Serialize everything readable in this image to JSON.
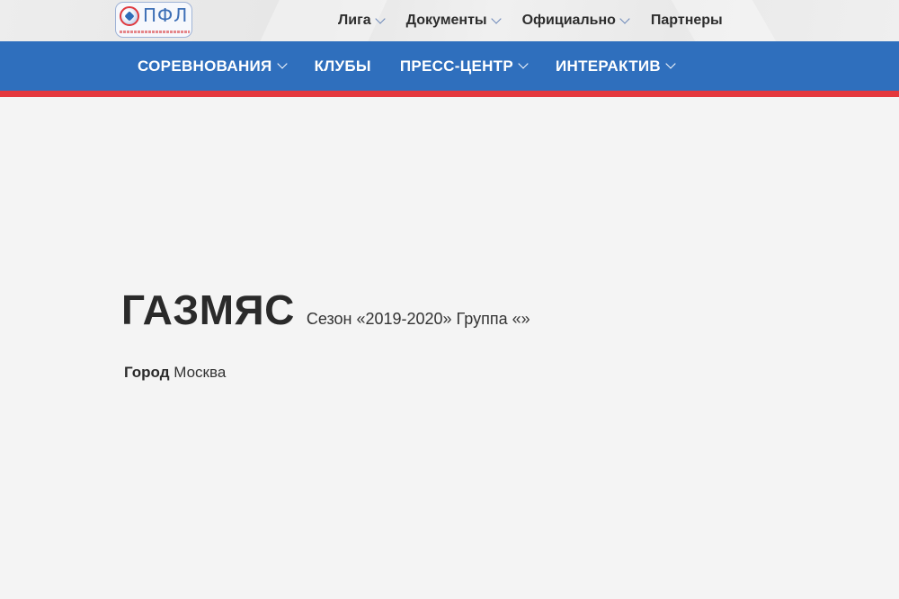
{
  "logo": {
    "text": "ПФЛ",
    "subtitle": "ПРОФЕССИОНАЛЬНАЯ ФУТБОЛЬНАЯ ЛИГА"
  },
  "top_nav": [
    {
      "label": "Лига",
      "has_dropdown": true
    },
    {
      "label": "Документы",
      "has_dropdown": true
    },
    {
      "label": "Официально",
      "has_dropdown": true
    },
    {
      "label": "Партнеры",
      "has_dropdown": false
    }
  ],
  "main_nav": [
    {
      "label": "СОРЕВНОВАНИЯ",
      "has_dropdown": true
    },
    {
      "label": "КЛУБЫ",
      "has_dropdown": false
    },
    {
      "label": "ПРЕСС-ЦЕНТР",
      "has_dropdown": true
    },
    {
      "label": "ИНТЕРАКТИВ",
      "has_dropdown": true
    }
  ],
  "club": {
    "name": "ГАЗМЯС",
    "season": "Сезон «2019-2020» Группа «»",
    "city_label": "Город",
    "city_value": "Москва"
  },
  "colors": {
    "main_nav_bg": "#2f6fbd",
    "accent_red": "#e4383d",
    "page_bg": "#f4f4f4"
  }
}
